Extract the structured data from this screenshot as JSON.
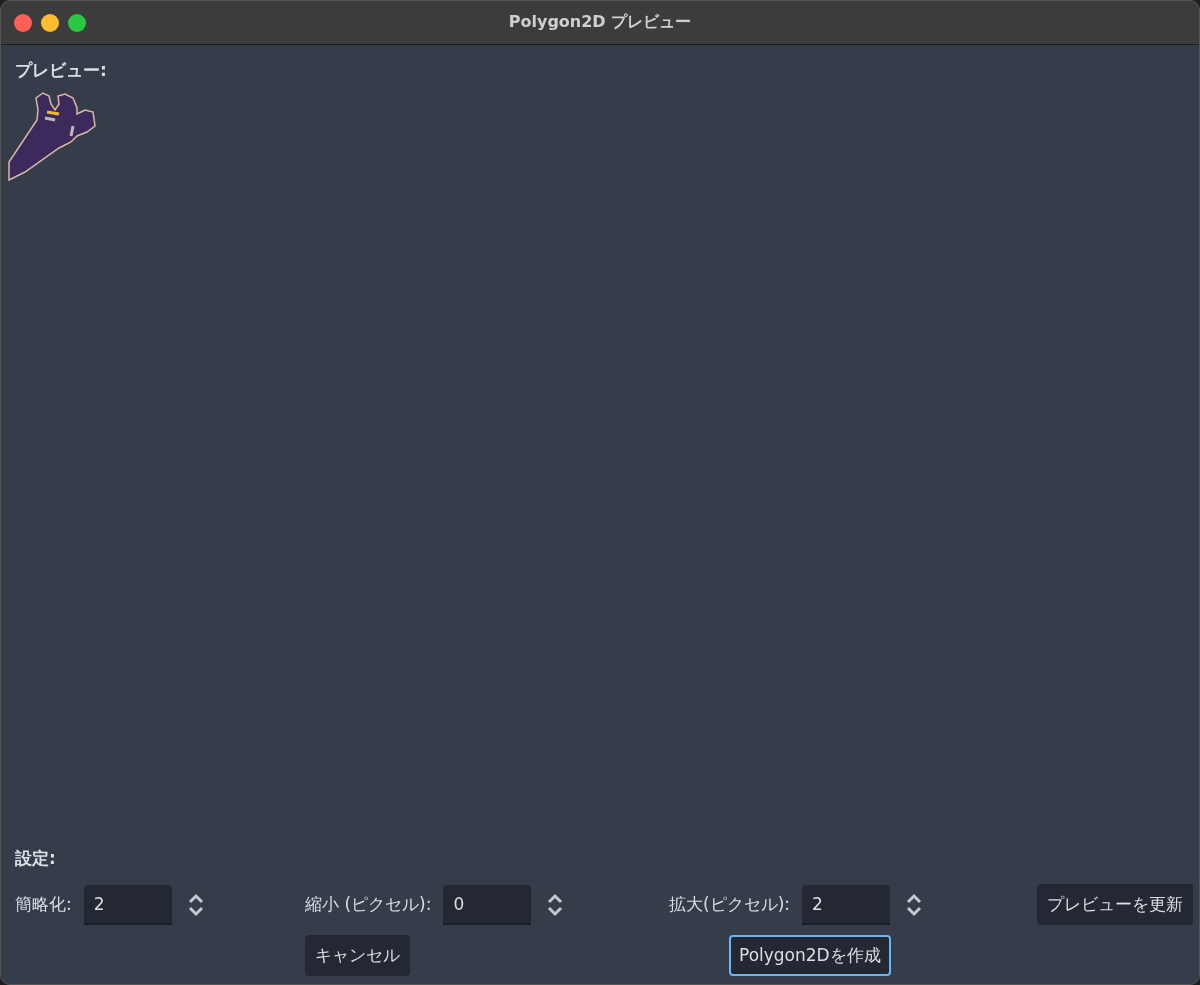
{
  "window": {
    "title": "Polygon2D プレビュー"
  },
  "preview": {
    "label": "プレビュー:"
  },
  "settings": {
    "label": "設定:",
    "fields": [
      {
        "label": "簡略化:",
        "value": "2"
      },
      {
        "label": "縮小 (ピクセル):",
        "value": "0"
      },
      {
        "label": "拡大(ピクセル):",
        "value": "2"
      }
    ],
    "update_button": "プレビューを更新"
  },
  "buttons": [
    {
      "label": "キャンセル",
      "focused": false
    },
    {
      "label": "Polygon2Dを作成",
      "focused": true
    }
  ]
}
